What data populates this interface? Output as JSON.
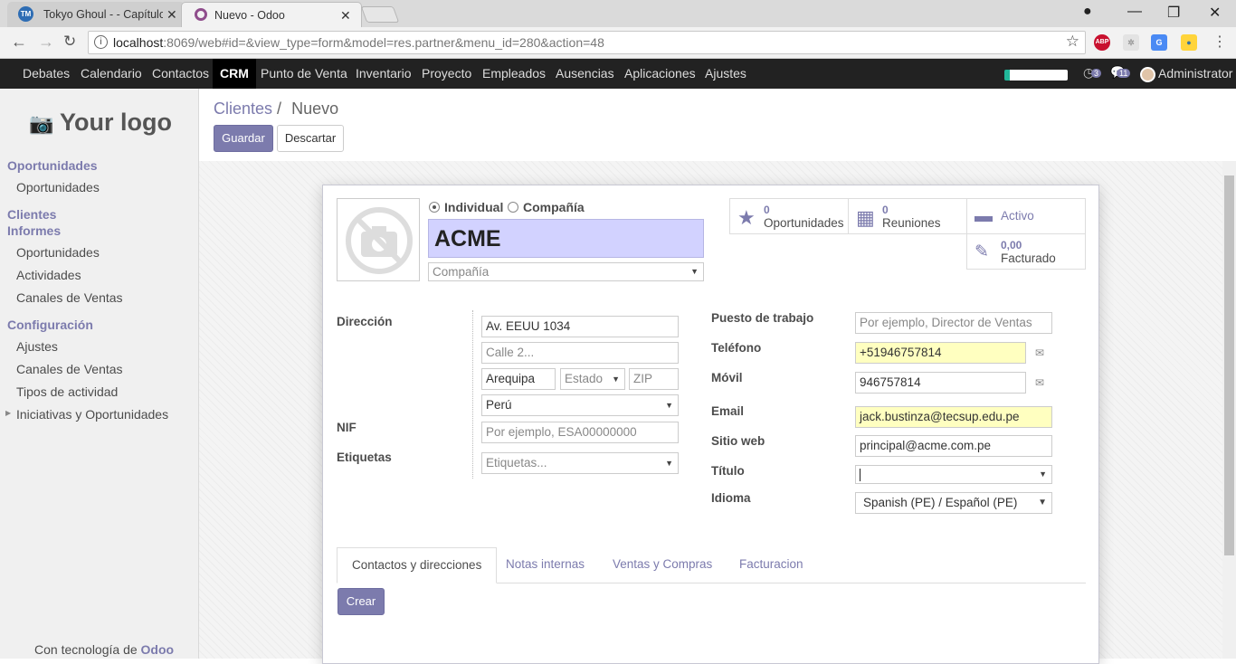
{
  "browser": {
    "tabs": [
      {
        "title": "Tokyo Ghoul - - Capítulo",
        "active": false
      },
      {
        "title": "Nuevo - Odoo",
        "active": true
      }
    ],
    "url_host": "localhost",
    "url_rest": ":8069/web#id=&view_type=form&model=res.partner&menu_id=280&action=48",
    "ext_abp": "ABP"
  },
  "menu": {
    "items": [
      "Debates",
      "Calendario",
      "Contactos",
      "CRM",
      "Punto de Venta",
      "Inventario",
      "Proyecto",
      "Empleados",
      "Ausencias",
      "Aplicaciones",
      "Ajustes"
    ],
    "active": "CRM",
    "activity_count": "3",
    "message_count": "11",
    "user": "Administrator"
  },
  "sidebar": {
    "logo_text": "Your logo",
    "sections": [
      {
        "title": "Oportunidades",
        "items": [
          "Oportunidades"
        ]
      },
      {
        "title": "Clientes",
        "items": []
      },
      {
        "title": "Informes",
        "items": [
          "Oportunidades",
          "Actividades",
          "Canales de Ventas"
        ]
      },
      {
        "title": "Configuración",
        "items": [
          "Ajustes",
          "Canales de Ventas",
          "Tipos de actividad",
          "Iniciativas y Oportunidades"
        ]
      }
    ],
    "footer_prefix": "Con tecnología de ",
    "footer_brand": "Odoo"
  },
  "breadcrumb": {
    "parent": "Clientes",
    "sep": "/",
    "current": "Nuevo"
  },
  "buttons": {
    "save": "Guardar",
    "discard": "Descartar",
    "create": "Crear"
  },
  "form": {
    "type_individual": "Individual",
    "type_company": "Compañía",
    "name": "ACME",
    "company_placeholder": "Compañía",
    "stats": {
      "opportunities": {
        "value": "0",
        "label": "Oportunidades"
      },
      "meetings": {
        "value": "0",
        "label": "Reuniones"
      },
      "active": {
        "label": "Activo"
      },
      "invoiced": {
        "value": "0,00",
        "label": "Facturado"
      }
    },
    "labels": {
      "address": "Dirección",
      "vat": "NIF",
      "tags": "Etiquetas",
      "job": "Puesto de trabajo",
      "phone": "Teléfono",
      "mobile": "Móvil",
      "email": "Email",
      "website": "Sitio web",
      "title": "Título",
      "lang": "Idioma"
    },
    "values": {
      "street": "Av. EEUU 1034",
      "street2_placeholder": "Calle 2...",
      "city": "Arequipa",
      "state_placeholder": "Estado",
      "zip_placeholder": "ZIP",
      "country": "Perú",
      "vat_placeholder": "Por ejemplo, ESA00000000",
      "tags_placeholder": "Etiquetas...",
      "job_placeholder": "Por ejemplo, Director de Ventas",
      "phone": "+51946757814",
      "mobile": "946757814",
      "email": "jack.bustinza@tecsup.edu.pe",
      "website": "principal@acme.com.pe",
      "title": "",
      "lang": "Spanish (PE) / Español (PE)"
    },
    "tabs": [
      "Contactos y direcciones",
      "Notas internas",
      "Ventas y Compras",
      "Facturacion"
    ]
  }
}
